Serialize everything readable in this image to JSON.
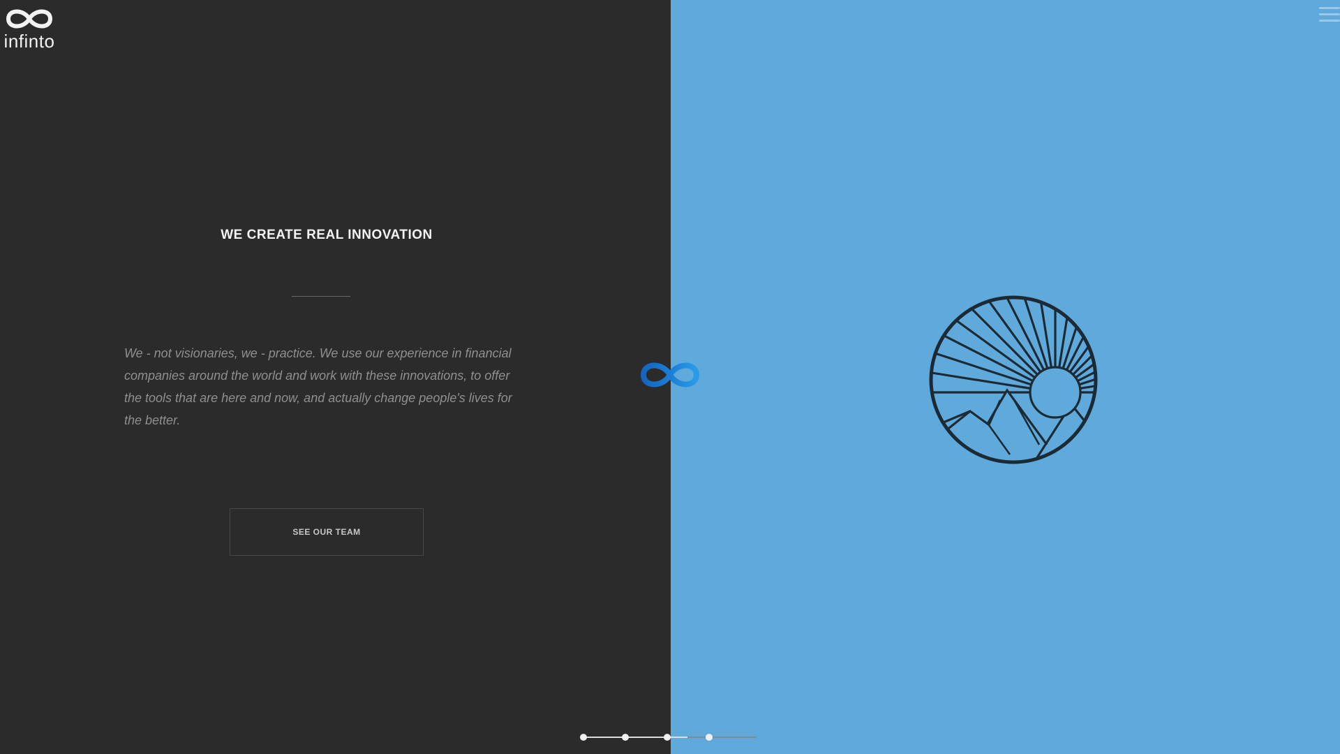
{
  "brand": {
    "logo_icon": "infinity-icon",
    "name": "infinto"
  },
  "header": {
    "menu_icon": "hamburger-menu-icon"
  },
  "hero": {
    "title": "WE CREATE REAL INNOVATION",
    "body": "We - not visionaries, we - practice. We use our experience in financial companies around the world and work with these innovations, to offer the tools that are here and now, and actually change people's lives for the better.",
    "cta_label": "SEE OUR TEAM"
  },
  "center_mark": {
    "icon": "infinity-icon",
    "color": "#1a7ed6"
  },
  "illustration": {
    "icon": "sun-mountains-emblem-icon"
  },
  "colors": {
    "left_panel": "#2b2b2b",
    "right_panel": "#5faadb",
    "accent": "#1a7ed6"
  },
  "pagination": {
    "total_steps": 4,
    "current_step": 3,
    "progress_fraction": 0.6
  }
}
